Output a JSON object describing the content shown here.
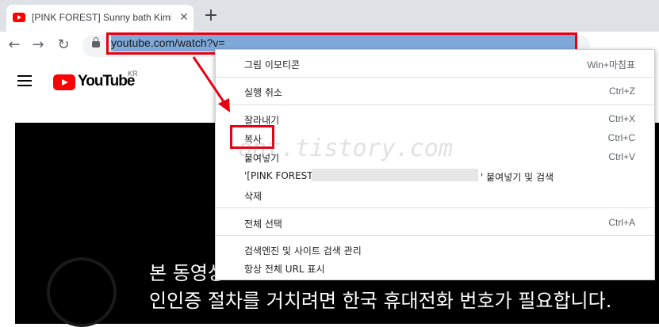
{
  "tab": {
    "title": "[PINK FOREST] Sunny bath Kimi",
    "close_icon": "close-icon"
  },
  "newtab_label": "+",
  "nav": {
    "back": "←",
    "forward": "→",
    "reload": "↻"
  },
  "omnibox": {
    "url": "youtube.com/watch?v="
  },
  "youtube": {
    "logo_text": "YouTube",
    "region": "KR"
  },
  "subtitles": {
    "line1": "본 동영상",
    "line2": "인인증 절차를 거치려면 한국 휴대전화 번호가 필요합니다."
  },
  "watermark": "ont.tistory.com",
  "context_menu": {
    "items": [
      {
        "label": "그림 이모티콘",
        "shortcut": "Win+마침표"
      },
      {
        "label": "실행 취소",
        "shortcut": "Ctrl+Z"
      },
      {
        "label": "잘라내기",
        "shortcut": "Ctrl+X"
      },
      {
        "label": "복사",
        "shortcut": "Ctrl+C"
      },
      {
        "label": "붙여넣기",
        "shortcut": "Ctrl+V"
      },
      {
        "label": "'[PINK FOREST]",
        "suffix": "' 붙여넣기 및 검색"
      },
      {
        "label": "삭제"
      },
      {
        "label": "전체 선택",
        "shortcut": "Ctrl+A"
      },
      {
        "label": "검색엔진 및 사이트 검색 관리"
      },
      {
        "label": "항상 전체 URL 표시"
      }
    ]
  },
  "colors": {
    "highlight_red": "#e60012",
    "url_selection": "#7fa8d8",
    "youtube_red": "#ff0000"
  }
}
